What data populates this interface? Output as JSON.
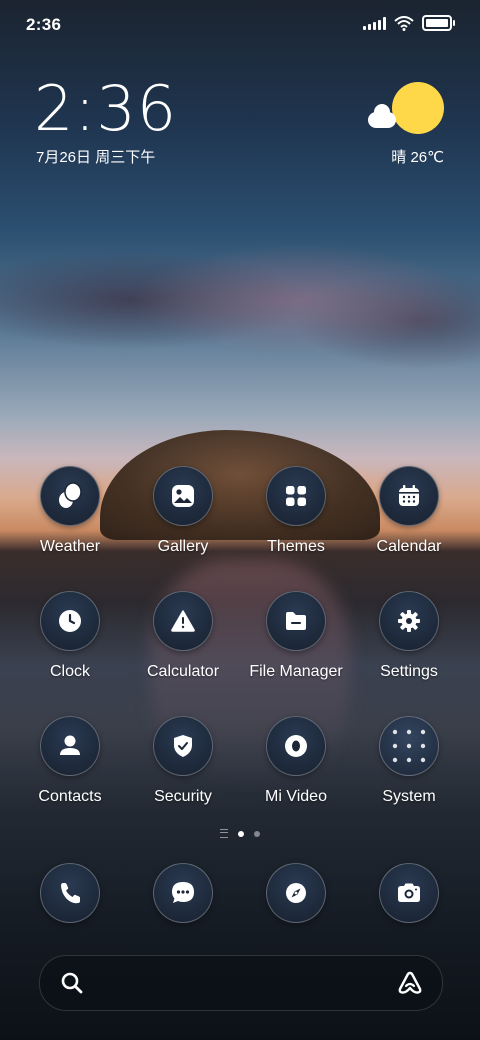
{
  "status_bar": {
    "time": "2:36",
    "icons": [
      "signal-icon",
      "wifi-icon",
      "battery-icon"
    ],
    "battery_level": 0.9
  },
  "clock_widget": {
    "time": "2:36",
    "date": "7月26日 周三下午"
  },
  "weather_widget": {
    "icon": "sun-cloud-icon",
    "text": "晴 26℃"
  },
  "apps": {
    "weather": {
      "label": "Weather",
      "icon": "weather-icon"
    },
    "gallery": {
      "label": "Gallery",
      "icon": "gallery-icon"
    },
    "themes": {
      "label": "Themes",
      "icon": "themes-icon"
    },
    "calendar": {
      "label": "Calendar",
      "icon": "calendar-icon"
    },
    "clock": {
      "label": "Clock",
      "icon": "clock-icon"
    },
    "calculator": {
      "label": "Calculator",
      "icon": "calculator-icon"
    },
    "file_manager": {
      "label": "File Manager",
      "icon": "folder-icon"
    },
    "settings": {
      "label": "Settings",
      "icon": "gear-icon"
    },
    "contacts": {
      "label": "Contacts",
      "icon": "contacts-icon"
    },
    "security": {
      "label": "Security",
      "icon": "shield-icon"
    },
    "mi_video": {
      "label": "Mi Video",
      "icon": "video-icon"
    },
    "system": {
      "label": "System",
      "icon": "folder-grid-icon"
    }
  },
  "page_indicator": {
    "pages": 2,
    "current": 1
  },
  "dock": {
    "items": [
      "phone-icon",
      "messages-icon",
      "browser-icon",
      "camera-icon"
    ]
  },
  "search_bar": {
    "icons": [
      "search-icon",
      "assistant-icon"
    ]
  },
  "colors": {
    "icon_bg": "#1c2636",
    "sun": "#ffd84a",
    "text": "#ffffff"
  }
}
